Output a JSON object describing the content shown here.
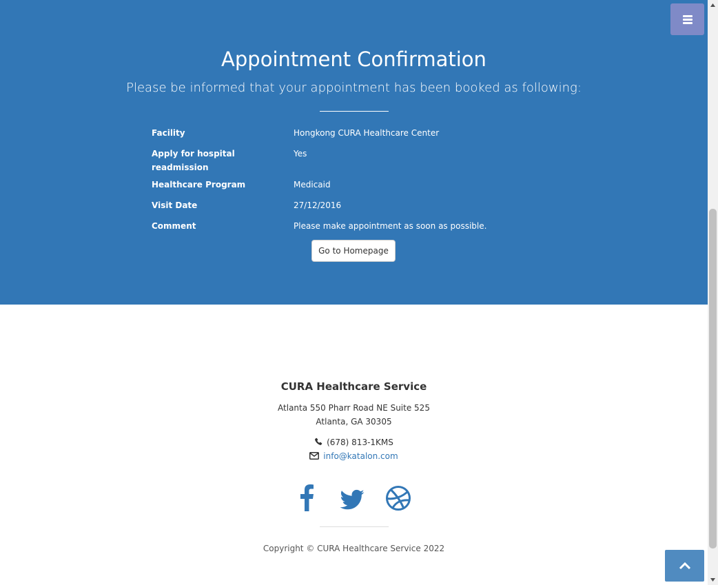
{
  "header": {
    "title": "Appointment Confirmation",
    "subtitle": "Please be informed that your appointment has been booked as following:"
  },
  "appointment": {
    "rows": [
      {
        "label": "Facility",
        "value": "Hongkong CURA Healthcare Center"
      },
      {
        "label": "Apply for hospital readmission",
        "value": "Yes"
      },
      {
        "label": "Healthcare Program",
        "value": "Medicaid"
      },
      {
        "label": "Visit Date",
        "value": "27/12/2016"
      },
      {
        "label": "Comment",
        "value": "Please make appointment as soon as possible."
      }
    ],
    "home_button_label": "Go to Homepage"
  },
  "footer": {
    "company": "CURA Healthcare Service",
    "address_line1": "Atlanta 550 Pharr Road NE Suite 525",
    "address_line2": "Atlanta, GA 30305",
    "phone": "(678) 813-1KMS",
    "email": "info@katalon.com",
    "social_icons": [
      "facebook-icon",
      "twitter-icon",
      "dribbble-icon"
    ],
    "copyright": "Copyright © CURA Healthcare Service 2022"
  },
  "colors": {
    "hero_blue": "#3277b6",
    "menu_toggle": "#7f8ac7",
    "link": "#3277b6"
  },
  "icons": {
    "menu": "menu-bars-icon",
    "phone": "phone-icon",
    "email": "envelope-icon",
    "to_top": "chevron-up-icon"
  }
}
